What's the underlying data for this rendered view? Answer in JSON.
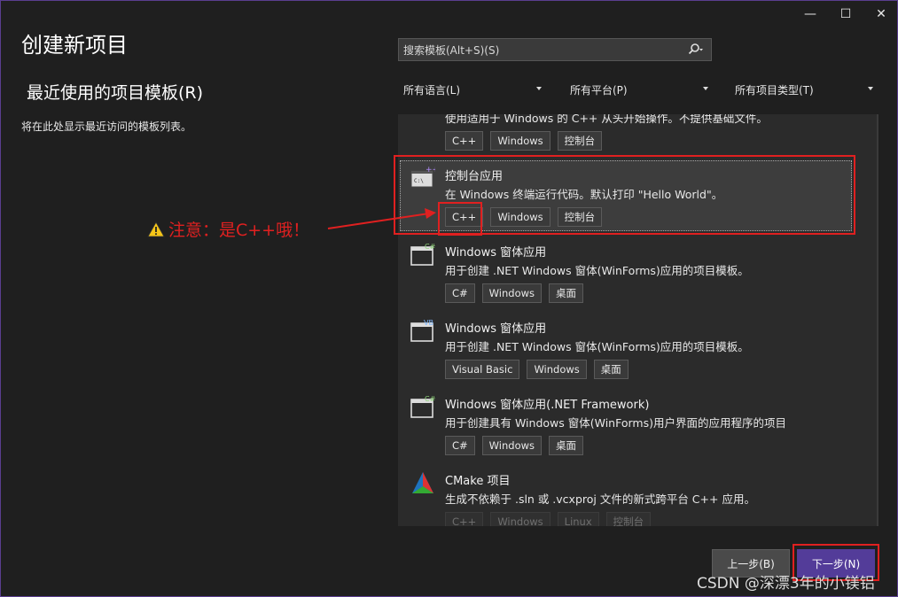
{
  "window": {
    "minimize_glyph": "—",
    "maximize_glyph": "☐",
    "close_glyph": "✕"
  },
  "page_title": "创建新项目",
  "recent": {
    "title": "最近使用的项目模板(R)",
    "empty_text": "将在此处显示最近访问的模板列表。"
  },
  "search": {
    "placeholder": "搜索模板(Alt+S)(S)"
  },
  "filters": {
    "language": "所有语言(L)",
    "platform": "所有平台(P)",
    "project_type": "所有项目类型(T)"
  },
  "templates": [
    {
      "name": "",
      "desc": "使用适用于 Windows 的 C++ 从头开始操作。不提供基础文件。",
      "tags": [
        "C++",
        "Windows",
        "控制台"
      ],
      "icon": "empty-project-icon"
    },
    {
      "name": "控制台应用",
      "desc": "在 Windows 终端运行代码。默认打印 \"Hello World\"。",
      "tags": [
        "C++",
        "Windows",
        "控制台"
      ],
      "icon": "console-app-icon",
      "selected": true
    },
    {
      "name": "Windows 窗体应用",
      "desc": "用于创建 .NET Windows 窗体(WinForms)应用的项目模板。",
      "tags": [
        "C#",
        "Windows",
        "桌面"
      ],
      "icon": "winforms-csharp-icon",
      "badge": "C#"
    },
    {
      "name": "Windows 窗体应用",
      "desc": "用于创建 .NET Windows 窗体(WinForms)应用的项目模板。",
      "tags": [
        "Visual Basic",
        "Windows",
        "桌面"
      ],
      "icon": "winforms-vb-icon",
      "badge": "VB"
    },
    {
      "name": "Windows 窗体应用(.NET Framework)",
      "desc": "用于创建具有 Windows 窗体(WinForms)用户界面的应用程序的项目",
      "tags": [
        "C#",
        "Windows",
        "桌面"
      ],
      "icon": "winforms-framework-icon",
      "badge": "C#"
    },
    {
      "name": "CMake 项目",
      "desc": "生成不依赖于 .sln 或 .vcxproj 文件的新式跨平台 C++ 应用。",
      "tags": [
        "C++",
        "Windows",
        "Linux",
        "控制台"
      ],
      "icon": "cmake-icon"
    }
  ],
  "annotation": {
    "text": "注意：是C++哦！"
  },
  "buttons": {
    "back": "上一步(B)",
    "next": "下一步(N)"
  },
  "watermark": "CSDN @深漂3年的小镁铝",
  "colors": {
    "accent": "#533c99",
    "highlight_red": "#e02020",
    "background": "#1f1f1f"
  }
}
